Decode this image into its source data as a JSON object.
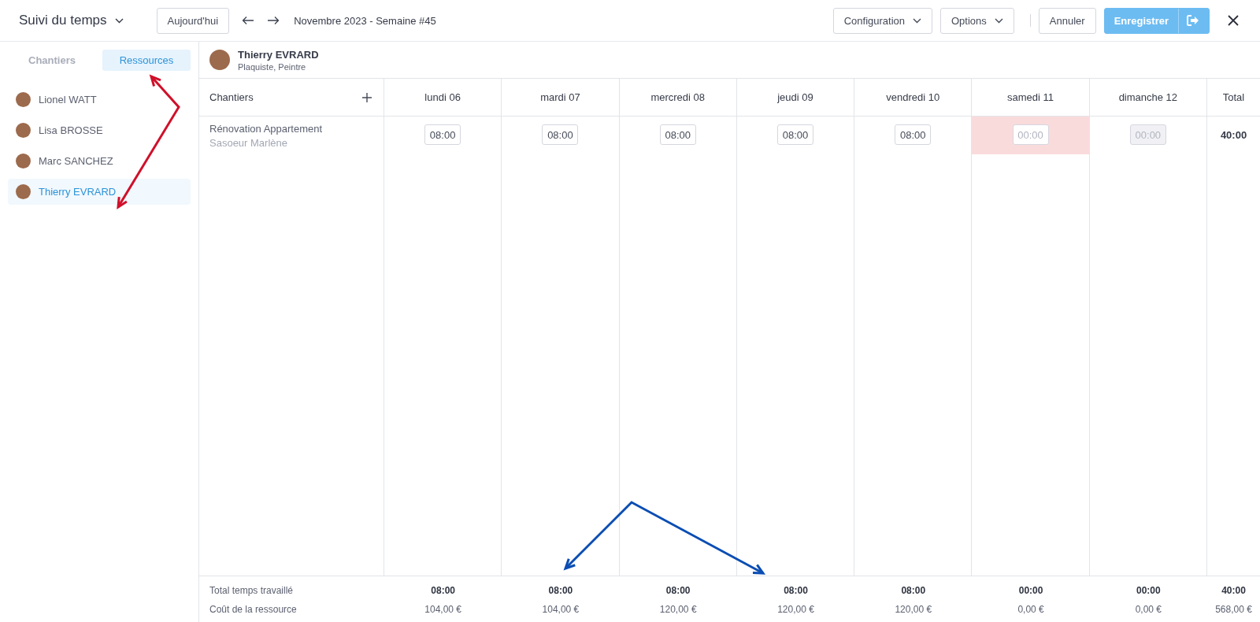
{
  "header": {
    "title": "Suivi du temps",
    "today_button": "Aujourd'hui",
    "period": "Novembre 2023 - Semaine #45",
    "buttons": [
      {
        "label": "Configuration",
        "kind": "dropdown"
      },
      {
        "label": "Options",
        "kind": "dropdown"
      },
      {
        "label": "Annuler",
        "kind": "plain"
      },
      {
        "label": "Enregistrer",
        "kind": "primary"
      }
    ]
  },
  "sidebar": {
    "tabs": [
      {
        "label": "Chantiers",
        "selected": false
      },
      {
        "label": "Ressources",
        "selected": true
      }
    ],
    "resources": [
      {
        "name": "Lionel WATT",
        "selected": false
      },
      {
        "name": "Lisa BROSSE",
        "selected": false
      },
      {
        "name": "Marc SANCHEZ",
        "selected": false
      },
      {
        "name": "Thierry EVRARD",
        "selected": true
      }
    ]
  },
  "person": {
    "name": "Thierry EVRARD",
    "roles": "Plaquiste, Peintre"
  },
  "table": {
    "first_column": "Chantiers",
    "total_label": "Total",
    "days": [
      "lundi 06",
      "mardi 07",
      "mercredi 08",
      "jeudi 09",
      "vendredi 10",
      "samedi 11",
      "dimanche 12"
    ],
    "rows": [
      {
        "title": "Rénovation Appartement",
        "client": "Sasoeur Marlène",
        "total": "40:00",
        "entries": [
          {
            "value": "08:00",
            "alert": false,
            "disabled": false
          },
          {
            "value": "08:00",
            "alert": false,
            "disabled": false
          },
          {
            "value": "08:00",
            "alert": false,
            "disabled": false
          },
          {
            "value": "08:00",
            "alert": false,
            "disabled": false
          },
          {
            "value": "08:00",
            "alert": false,
            "disabled": false
          },
          {
            "placeholder": "00:00",
            "alert": true,
            "disabled": false
          },
          {
            "placeholder": "00:00",
            "alert": false,
            "disabled": true
          }
        ]
      }
    ],
    "footer": [
      {
        "label": "Total temps travaillé",
        "kind": "bold",
        "values": [
          "08:00",
          "08:00",
          "08:00",
          "08:00",
          "08:00",
          "00:00",
          "00:00"
        ],
        "total": "40:00"
      },
      {
        "label": "Coût de la ressource",
        "kind": "plain",
        "values": [
          "104,00 €",
          "104,00 €",
          "120,00 €",
          "120,00 €",
          "120,00 €",
          "0,00 €",
          "0,00 €"
        ],
        "total": "568,00 €"
      }
    ]
  },
  "annotation_arrows": [
    {
      "color": "#d0102a"
    },
    {
      "color": "#0a4db3"
    }
  ]
}
